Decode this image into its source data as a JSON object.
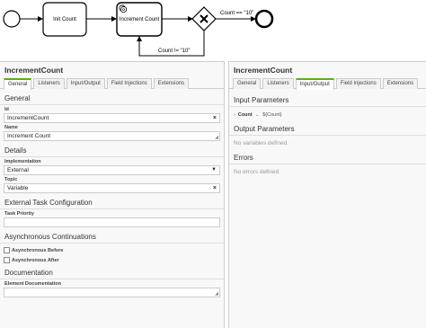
{
  "diagram": {
    "task_init": "Init Count",
    "task_increment": "Increment Count",
    "flow_yes": "Count == \"10\"",
    "flow_no": "Count != \"10\""
  },
  "left": {
    "title": "IncrementCount",
    "tabs": [
      "General",
      "Listeners",
      "Input/Output",
      "Field Injections",
      "Extensions"
    ],
    "active_tab": "General",
    "general": {
      "title": "General",
      "id_label": "Id",
      "id_value": "IncrementCount",
      "name_label": "Name",
      "name_value": "Increment Count"
    },
    "details": {
      "title": "Details",
      "impl_label": "Implementation",
      "impl_value": "External",
      "topic_label": "Topic",
      "topic_value": "Variable"
    },
    "external": {
      "title": "External Task Configuration",
      "priority_label": "Task Priority",
      "priority_value": ""
    },
    "async": {
      "title": "Asynchronous Continuations",
      "before_label": "Asynchronous Before",
      "after_label": "Asynchronous After"
    },
    "docs": {
      "title": "Documentation",
      "element_doc_label": "Element Documentation",
      "element_doc_value": ""
    }
  },
  "right": {
    "title": "IncrementCount",
    "tabs": [
      "General",
      "Listeners",
      "Input/Output",
      "Field Injections",
      "Extensions"
    ],
    "active_tab": "Input/Output",
    "input_title": "Input Parameters",
    "input_param": {
      "name": "Count",
      "arrow": "←",
      "value": "${Count}"
    },
    "output_title": "Output Parameters",
    "output_empty": "No variables defined.",
    "errors_title": "Errors",
    "errors_empty": "No errors defined."
  }
}
